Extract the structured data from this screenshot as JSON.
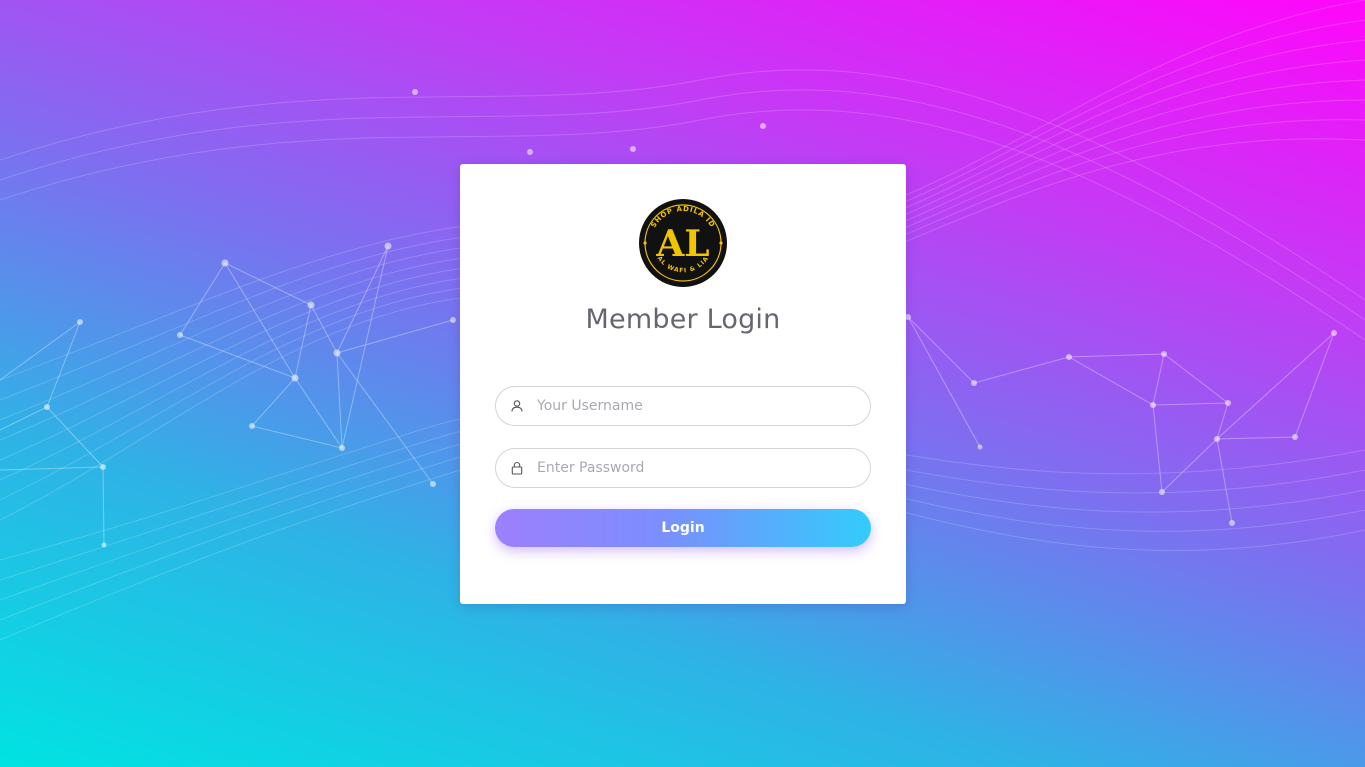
{
  "login": {
    "title": "Member Login",
    "username_placeholder": "Your Username",
    "password_placeholder": "Enter Password",
    "button_label": "Login"
  },
  "logo": {
    "monogram": "AL",
    "ring_text_top": "SHOP ADILA ID",
    "ring_text_bottom": "AL WAFI & LIA",
    "ring_color": "#f2c500",
    "fill_color": "#111111"
  },
  "icons": {
    "username": "user-icon",
    "password": "lock-icon"
  },
  "colors": {
    "bg_start": "#00e3e2",
    "bg_mid": "#7d6ff0",
    "bg_end": "#ff06fb",
    "button_start": "#9d7ffd",
    "button_end": "#33ccfb",
    "title_text": "#666670"
  }
}
